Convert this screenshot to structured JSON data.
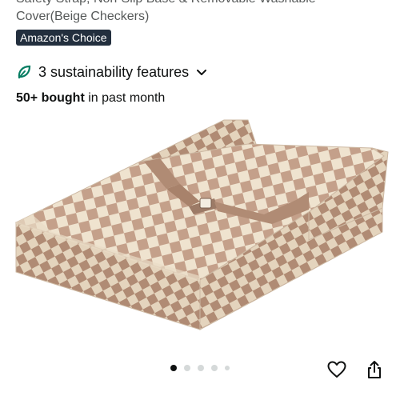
{
  "product": {
    "title_line_1": "Safety Strap, Non-Slip Base & Removable Washable",
    "title_line_2": "Cover(Beige Checkers)",
    "badge": "Amazon's Choice",
    "sustainability_label": "3 sustainability features",
    "bought_strong": "50+ bought",
    "bought_rest": " in past month"
  },
  "gallery": {
    "image_count": 5,
    "active_index": 0
  },
  "icons": {
    "leaf": "leaf-icon",
    "chevron": "chevron-down-icon",
    "heart": "heart-icon",
    "share": "share-icon"
  },
  "colors": {
    "badge_bg": "#232f3e",
    "leaf": "#067d62",
    "check_light": "#efe3cf",
    "check_dark": "#c4a08a"
  }
}
